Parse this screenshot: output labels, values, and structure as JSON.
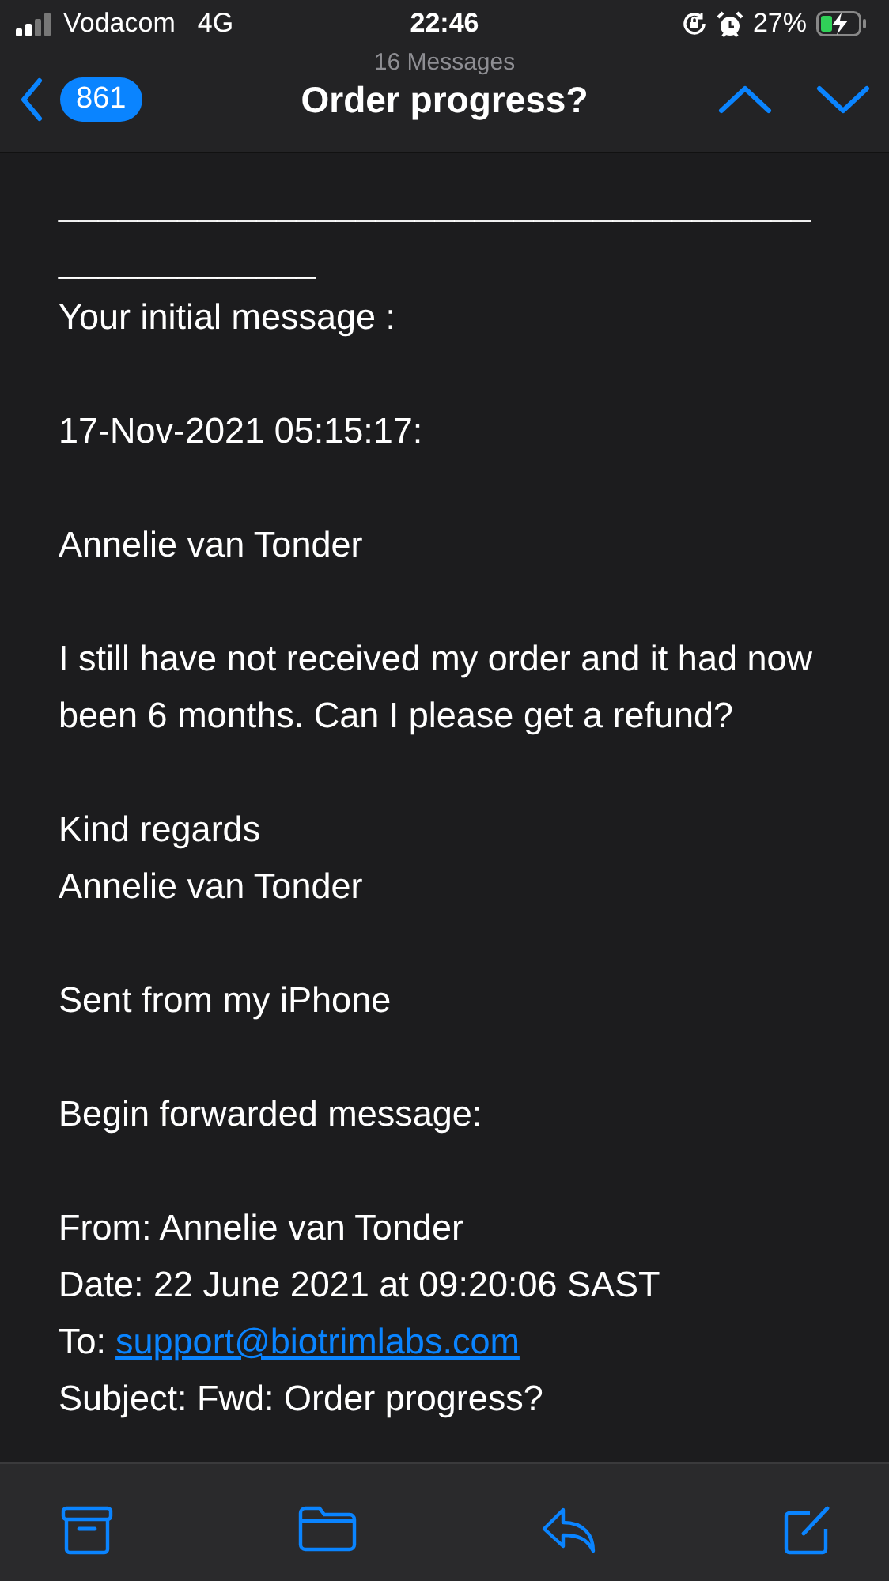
{
  "status_bar": {
    "carrier": "Vodacom",
    "network": "4G",
    "time": "22:46",
    "battery": "27%"
  },
  "nav": {
    "count": "16 Messages",
    "badge": "861",
    "title": "Order progress?"
  },
  "body": {
    "blocks": [
      {
        "lines": [
          {
            "kind": "rule",
            "text": "___________________________________________________"
          },
          {
            "kind": "text",
            "text": "Your initial message :"
          }
        ]
      },
      {
        "lines": [
          {
            "kind": "text",
            "text": "17-Nov-2021 05:15:17:"
          }
        ]
      },
      {
        "lines": [
          {
            "kind": "text",
            "text": "Annelie van Tonder"
          }
        ]
      },
      {
        "lines": [
          {
            "kind": "text",
            "text": "I still have not received my order and it had now been 6 months. Can I please get a refund?"
          }
        ]
      },
      {
        "lines": [
          {
            "kind": "text",
            "text": "Kind regards"
          },
          {
            "kind": "text",
            "text": "Annelie van Tonder"
          }
        ]
      },
      {
        "lines": [
          {
            "kind": "text",
            "text": "Sent from my iPhone"
          }
        ]
      },
      {
        "lines": [
          {
            "kind": "text",
            "text": "Begin forwarded message:"
          }
        ]
      },
      {
        "lines": [
          {
            "kind": "text",
            "text": "From: Annelie van Tonder"
          },
          {
            "kind": "text",
            "text": "Date: 22 June 2021 at 09:20:06 SAST"
          },
          {
            "kind": "link",
            "label": "To:",
            "link": "support@biotrimlabs.com"
          },
          {
            "kind": "text",
            "text": "Subject: Fwd: Order progress?"
          }
        ]
      }
    ]
  }
}
